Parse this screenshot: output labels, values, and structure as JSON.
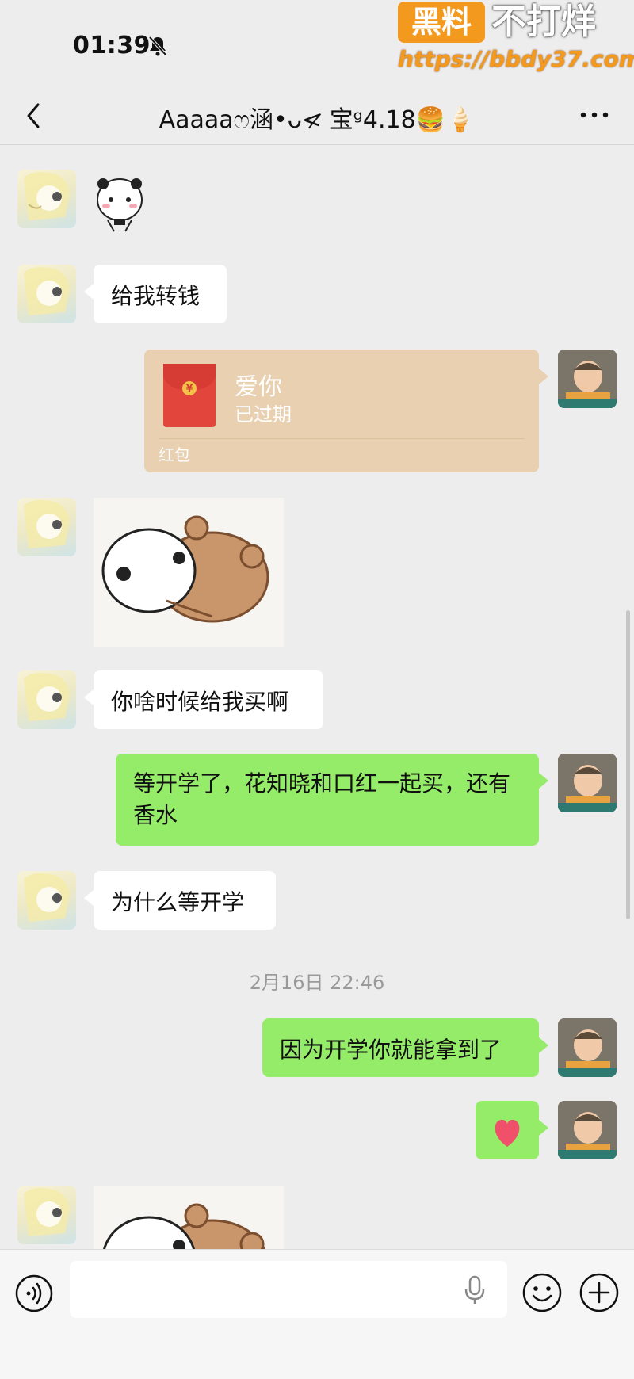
{
  "status_bar": {
    "time": "01:39"
  },
  "watermark": {
    "badge": "黑料",
    "text": "不打烊",
    "url": "https://bbdy37.com"
  },
  "nav": {
    "title": "Aaaaaෆ涵•ᴗ<̷ 宝ᵍ4.18🍔🍦"
  },
  "messages": {
    "m2": "给我转钱",
    "red_packet": {
      "title": "爱你",
      "status": "已过期",
      "label": "红包"
    },
    "m5": "你啥时候给我买啊",
    "m6": "等开学了，花知晓和口红一起买，还有香水",
    "m7": "为什么等开学",
    "timestamp": "2月16日 22:46",
    "m8": "因为开学你就能拿到了",
    "heart": "❤️"
  },
  "input": {
    "placeholder": ""
  },
  "icons": [
    "bell-mute-icon",
    "back-icon",
    "more-icon",
    "voice-icon",
    "mic-icon",
    "emoji-icon",
    "plus-icon",
    "heart-icon",
    "red-packet-icon"
  ],
  "colors": {
    "background": "#ededed",
    "sent_bubble": "#95ec69",
    "received_bubble": "#ffffff",
    "red_packet": "#e8d0b0"
  }
}
